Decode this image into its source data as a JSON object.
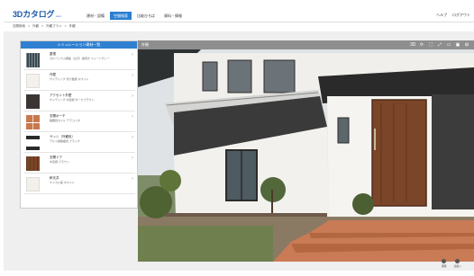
{
  "header": {
    "logo_main": "3Dカタログ",
    "logo_sub": ".com",
    "nav": [
      "建材・設備",
      "空間検索",
      "比較ひろば",
      "資料・情報"
    ],
    "nav_active_index": 1,
    "right": [
      "ヘルプ",
      "ログアウト"
    ]
  },
  "breadcrumb": [
    "空間検索",
    ">",
    "外観",
    ">",
    "外観プラン",
    ">",
    "外観"
  ],
  "left_panel": {
    "heading": "シミュレーション建材一覧",
    "items": [
      {
        "title": "屋根",
        "sub": "ガルバリウム鋼板（立平）縦葺き ストーングレー",
        "swatch": "#3a4a52"
      },
      {
        "title": "外壁",
        "sub": "サイディング 塗り壁調 ホワイト",
        "swatch": "#f4f1ec"
      },
      {
        "title": "アクセント外壁",
        "sub": "サイディング 木目調 ダークブラウン",
        "swatch": "#3b3533"
      },
      {
        "title": "玄関ポーチ",
        "sub": "磁器質タイル テラコッタ",
        "swatch": "#c8784e"
      },
      {
        "title": "サッシ（外観色）",
        "sub": "アルミ樹脂複合 ブラック",
        "swatch": "#2a2a2a"
      },
      {
        "title": "玄関ドア",
        "sub": "木目調 ブラウン",
        "swatch": "#7a4528"
      },
      {
        "title": "軒天井",
        "sub": "ケイカル板 ホワイト",
        "swatch": "#f3efe9"
      }
    ]
  },
  "viewer": {
    "title": "外観",
    "tools": [
      "3D",
      "⟳",
      "⛶",
      "⤢",
      "▭",
      "▣",
      "⊞"
    ]
  },
  "bottom_buttons": [
    "保存",
    "比較へ"
  ]
}
